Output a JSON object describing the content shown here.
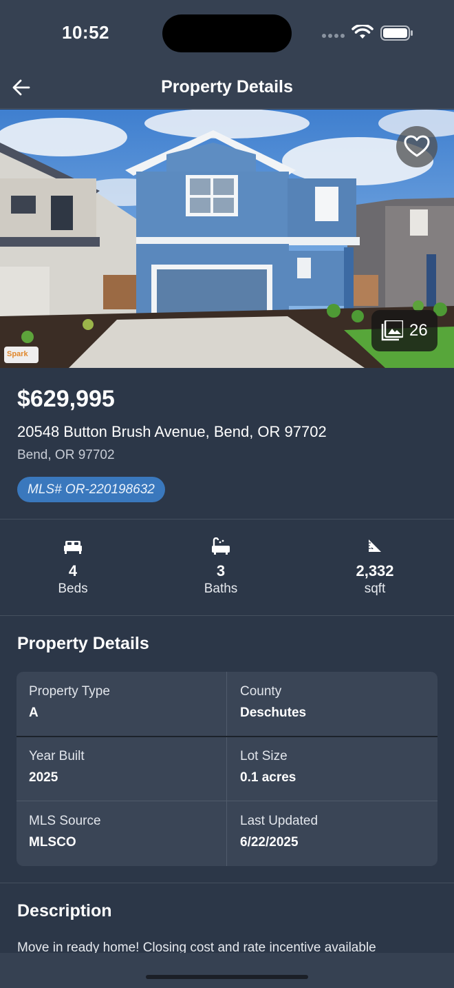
{
  "status_bar": {
    "time": "10:52"
  },
  "nav": {
    "title": "Property Details"
  },
  "gallery": {
    "photo_count": "26",
    "watermark": "Spark"
  },
  "listing": {
    "price": "$629,995",
    "address": "20548 Button Brush Avenue, Bend, OR 97702",
    "city_line": "Bend, OR 97702",
    "mls": "MLS# OR-220198632"
  },
  "stats": [
    {
      "icon": "bed-icon",
      "value": "4",
      "label": "Beds"
    },
    {
      "icon": "bath-icon",
      "value": "3",
      "label": "Baths"
    },
    {
      "icon": "ruler-icon",
      "value": "2,332",
      "label": "sqft"
    }
  ],
  "details": {
    "title": "Property Details",
    "cells": [
      {
        "label": "Property Type",
        "value": "A"
      },
      {
        "label": "County",
        "value": "Deschutes"
      },
      {
        "label": "Year Built",
        "value": "2025"
      },
      {
        "label": "Lot Size",
        "value": "0.1 acres"
      },
      {
        "label": "MLS Source",
        "value": "MLSCO"
      },
      {
        "label": "Last Updated",
        "value": "6/22/2025"
      }
    ]
  },
  "description": {
    "title": "Description",
    "text": "Move in ready home! Closing cost and rate incentive available"
  },
  "colors": {
    "background": "#2c3748",
    "bar": "#364152",
    "badge": "#3a78bd"
  }
}
